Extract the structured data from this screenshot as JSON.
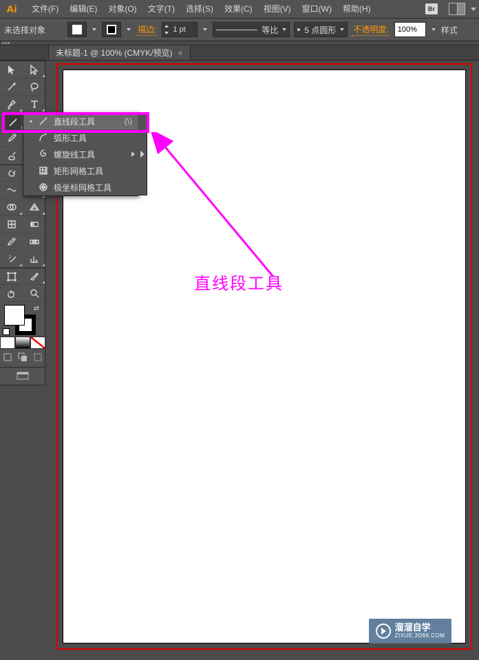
{
  "menubar": {
    "logo": "Ai",
    "items": [
      {
        "label": "文件(F)"
      },
      {
        "label": "编辑(E)"
      },
      {
        "label": "对象(O)"
      },
      {
        "label": "文字(T)"
      },
      {
        "label": "选择(S)"
      },
      {
        "label": "效果(C)"
      },
      {
        "label": "视图(V)"
      },
      {
        "label": "窗口(W)"
      },
      {
        "label": "帮助(H)"
      }
    ],
    "bridge_badge": "Br"
  },
  "optbar": {
    "no_selection": "未选择对象",
    "stroke_label": "描边:",
    "stroke_weight": "1 pt",
    "dash_label": "等比",
    "brush_label": "5 点圆形",
    "opacity_label": "不透明度:",
    "opacity_value": "100%",
    "style_label": "样式"
  },
  "tab": {
    "title": "未标题-1 @ 100% (CMYK/预览)"
  },
  "flyout": {
    "items": [
      {
        "label": "直线段工具",
        "shortcut": "(\\)",
        "icon": "line",
        "selected": true
      },
      {
        "label": "弧形工具",
        "icon": "arc"
      },
      {
        "label": "螺旋线工具",
        "icon": "spiral",
        "submenu": true
      },
      {
        "label": "矩形网格工具",
        "icon": "rectgrid"
      },
      {
        "label": "极坐标网格工具",
        "icon": "polargrid"
      }
    ]
  },
  "annotation": {
    "text": "直线段工具"
  },
  "watermark": {
    "title": "溜溜自学",
    "url": "ZIXUE.3D66.COM"
  },
  "tools_left": [
    "selection",
    "direct-selection",
    "magic-wand",
    "lasso",
    "pen",
    "type",
    "line",
    "rectangle",
    "paintbrush",
    "pencil",
    "blob-brush",
    "eraser",
    "rotate",
    "scale",
    "width",
    "free-transform",
    "shape-builder",
    "perspective",
    "mesh",
    "gradient",
    "eyedropper",
    "blend",
    "symbol-sprayer",
    "graph",
    "artboard",
    "slice",
    "hand",
    "zoom"
  ]
}
